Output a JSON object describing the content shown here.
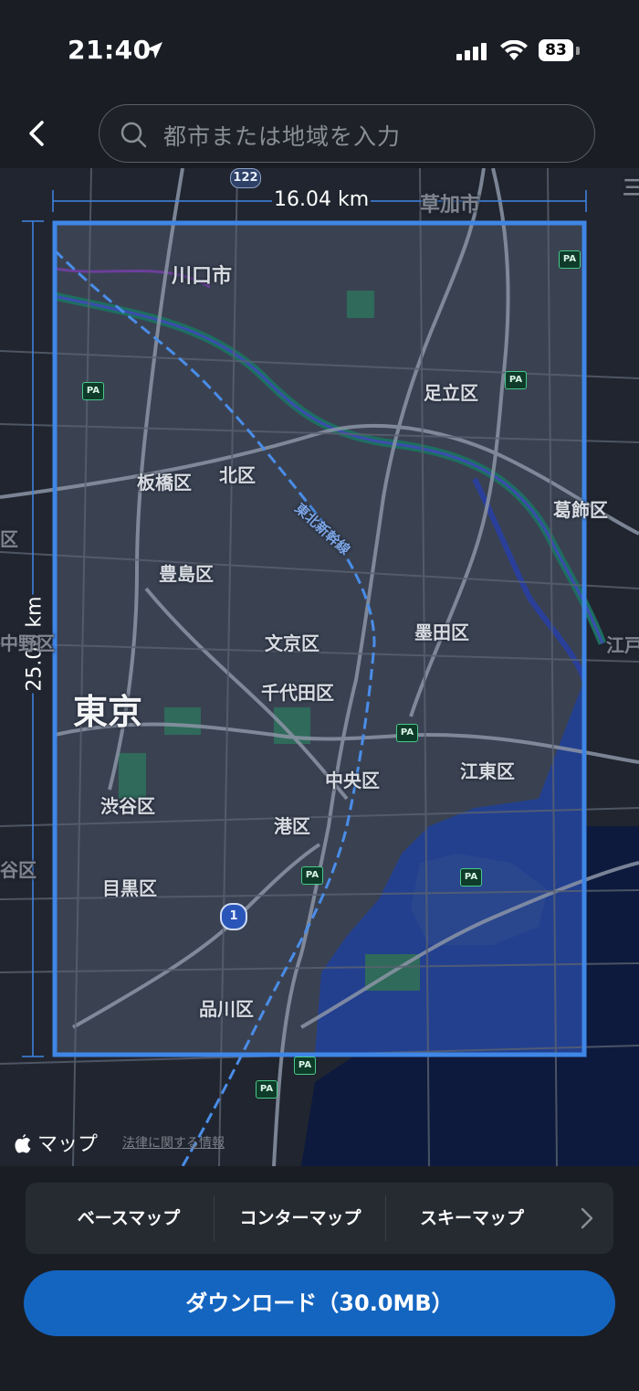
{
  "status_bar": {
    "time": "21:40",
    "battery_level": "83"
  },
  "search": {
    "placeholder": "都市または地域を入力"
  },
  "map": {
    "width_km": "16.04 km",
    "height_km": "25.00 km",
    "attribution": "マップ",
    "legal_link": "法律に関する情報",
    "labels": {
      "kawaguchi": "川口市",
      "soka": "草加市",
      "adachi": "足立区",
      "itabashi": "板橋区",
      "kita": "北区",
      "katsushika": "葛飾区",
      "toshima": "豊島区",
      "sumida": "墨田区",
      "bunkyo": "文京区",
      "tokyo": "東京",
      "chiyoda": "千代田区",
      "chuo": "中央区",
      "koto": "江東区",
      "shibuya": "渋谷区",
      "minato": "港区",
      "meguro": "目黒区",
      "shinagawa": "品川区",
      "edogawa_partial": "江戸",
      "left_edge_1": "区",
      "left_edge_2": "中野区",
      "left_edge_3": "谷区",
      "right_top": "三",
      "shinkansen": "東北新幹線"
    },
    "route_shields": {
      "r122": "122",
      "r1": "1"
    },
    "pa_badge": "PA",
    "selection_border_color": "#3f86e6"
  },
  "layers": {
    "tabs": [
      "ベースマップ",
      "コンターマップ",
      "スキーマップ"
    ]
  },
  "download": {
    "label": "ダウンロード（30.0MB）"
  },
  "colors": {
    "accent": "#1465c0",
    "background": "#1a1d24"
  }
}
